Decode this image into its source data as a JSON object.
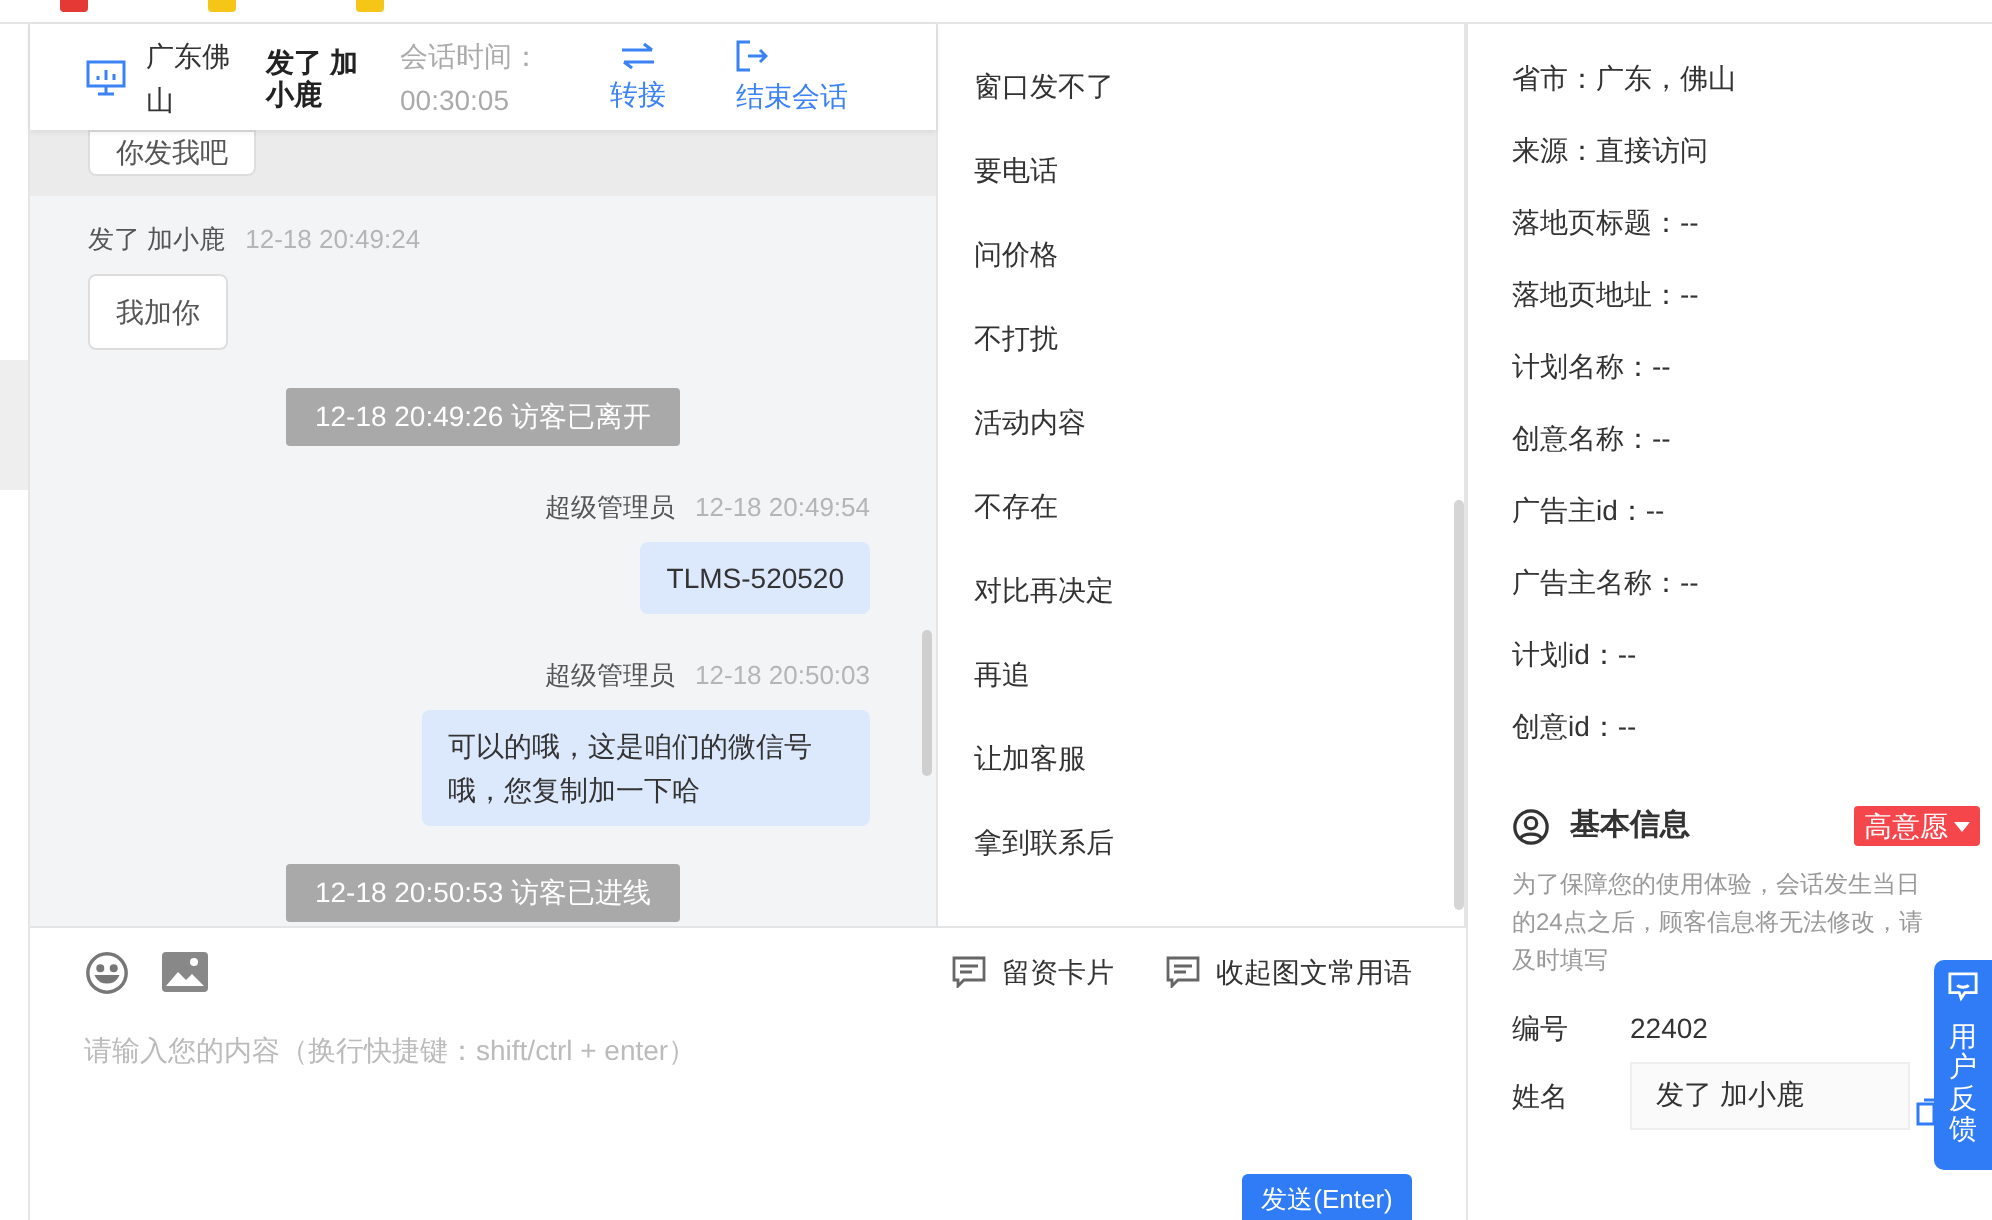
{
  "chat": {
    "header": {
      "location": "广东佛山",
      "visitor": "发了 加小鹿",
      "duration_label": "会话时间：",
      "duration": "00:30:05",
      "actions": [
        {
          "label": "转接",
          "kind": "transfer"
        },
        {
          "label": "结束会话",
          "kind": "end"
        }
      ]
    },
    "messages": [
      {
        "kind": "visitor_bubble",
        "text": "你发我吧"
      },
      {
        "kind": "visitor",
        "sender": "发了 加小鹿",
        "time": "12-18 20:49:24",
        "text": "我加你"
      },
      {
        "kind": "system",
        "text": "12-18 20:49:26 访客已离开"
      },
      {
        "kind": "agent",
        "sender": "超级管理员",
        "time": "12-18 20:49:54",
        "text": "TLMS-520520"
      },
      {
        "kind": "agent",
        "sender": "超级管理员",
        "time": "12-18 20:50:03",
        "text": "可以的哦，这是咱们的微信号哦，您复制加一下哈"
      },
      {
        "kind": "system",
        "text": "12-18 20:50:53 访客已进线"
      }
    ],
    "composer": {
      "tools": [
        "留资卡片",
        "收起图文常用语"
      ],
      "placeholder": "请输入您的内容（换行快捷键：shift/ctrl + enter）",
      "send": "发送(Enter)"
    }
  },
  "quick_replies": [
    "窗口发不了",
    "要电话",
    "问价格",
    "不打扰",
    "活动内容",
    "不存在",
    "对比再决定",
    "再追",
    "让加客服",
    "拿到联系后"
  ],
  "visitor_info": [
    "省市：广东，佛山",
    "来源：直接访问",
    "落地页标题：--",
    "落地页地址：--",
    "计划名称：--",
    "创意名称：--",
    "广告主id：--",
    "广告主名称：--",
    "计划id：--",
    "创意id：--"
  ],
  "basic_info": {
    "title": "基本信息",
    "intent": "高意愿",
    "note": "为了保障您的使用体验，会话发生当日的24点之后，顾客信息将无法修改，请及时填写",
    "fields": [
      {
        "kind": "text",
        "label": "编号",
        "value": "22402"
      },
      {
        "kind": "input",
        "label": "姓名",
        "value": "发了 加小鹿"
      }
    ]
  },
  "feedback": {
    "label": "用户反馈"
  }
}
